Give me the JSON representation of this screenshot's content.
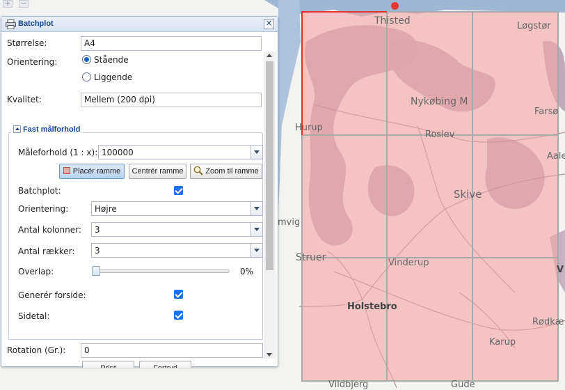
{
  "map": {
    "zoom_in": "+",
    "zoom_out": "−",
    "labels": [
      "Thisted",
      "Løgstør",
      "Nykøbing M",
      "Farsø",
      "Hurup",
      "Roslev",
      "Aale",
      "Skive",
      "mvig",
      "Struer",
      "Vinderup",
      "V",
      "Holstebro",
      "Rødkæ",
      "Karup",
      "Vildbjerg",
      "Gude"
    ],
    "colors": {
      "water": "#9fb7d4",
      "land": "#f3f3f1",
      "grid_fill": "#f4a6a6",
      "grid_border": "#a9a9a9",
      "selected_border": "#e03030"
    }
  },
  "panel": {
    "title": "Batchplot",
    "close_label": "✕",
    "size_label": "Størrelse:",
    "size_value": "A4",
    "orientation_label": "Orientering:",
    "orientation_options": [
      "Stående",
      "Liggende"
    ],
    "orientation_selected": "Stående",
    "quality_label": "Kvalitet:",
    "quality_value": "Mellem (200 dpi)",
    "fieldset_title": "Fast målforhold",
    "scale_label": "Måleforhold (1 : x):",
    "scale_value": "100000",
    "btn_place": "Placér ramme",
    "btn_center": "Centrér ramme",
    "btn_zoom": "Zoom til ramme",
    "batchplot_label": "Batchplot:",
    "batch_orientation_label": "Orientering:",
    "batch_orientation_value": "Højre",
    "columns_label": "Antal kolonner:",
    "columns_value": "3",
    "rows_label": "Antal rækker:",
    "rows_value": "3",
    "overlap_label": "Overlap:",
    "overlap_value": "0%",
    "frontpage_label": "Generér forside:",
    "pagenum_label": "Sidetal:",
    "rotation_label": "Rotation (Gr.):",
    "rotation_value": "0",
    "print_label": "Print",
    "cancel_label": "Fortryd",
    "checks": {
      "batchplot": true,
      "frontpage": true,
      "pagenum": true
    }
  }
}
